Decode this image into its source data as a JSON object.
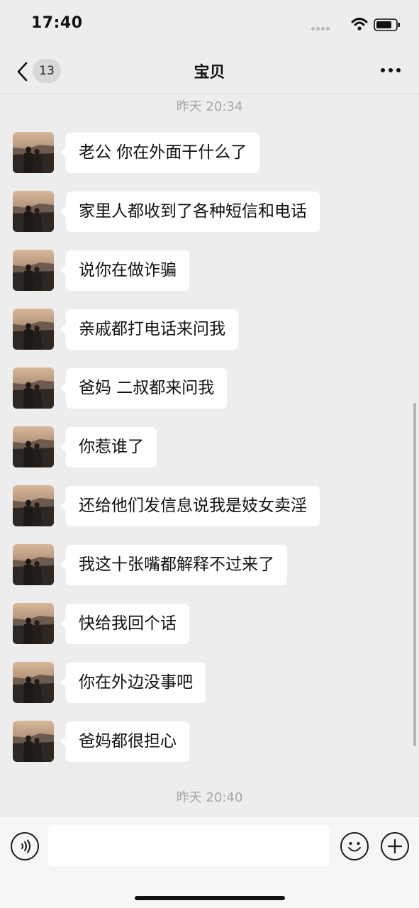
{
  "status_bar": {
    "time": "17:40"
  },
  "nav": {
    "back_badge": "13",
    "title": "宝贝"
  },
  "chat": {
    "timestamp_top": "昨天 20:34",
    "messages": [
      "老公 你在外面干什么了",
      "家里人都收到了各种短信和电话",
      "说你在做诈骗",
      "亲戚都打电话来问我",
      "爸妈 二叔都来问我",
      "你惹谁了",
      "还给他们发信息说我是妓女卖淫",
      "我这十张嘴都解释不过来了",
      "快给我回个话",
      "你在外边没事吧",
      "爸妈都很担心"
    ],
    "timestamp_bottom": "昨天 20:40"
  },
  "input": {
    "value": ""
  },
  "icons": {
    "back": "chevron-left-icon",
    "more": "more-dots-icon",
    "voice": "voice-icon",
    "emoji": "emoji-icon",
    "plus": "plus-icon",
    "wifi": "wifi-icon",
    "battery": "battery-icon"
  },
  "colors": {
    "background": "#ededed",
    "bubble": "#ffffff",
    "timestamp": "#a6a6a6"
  }
}
